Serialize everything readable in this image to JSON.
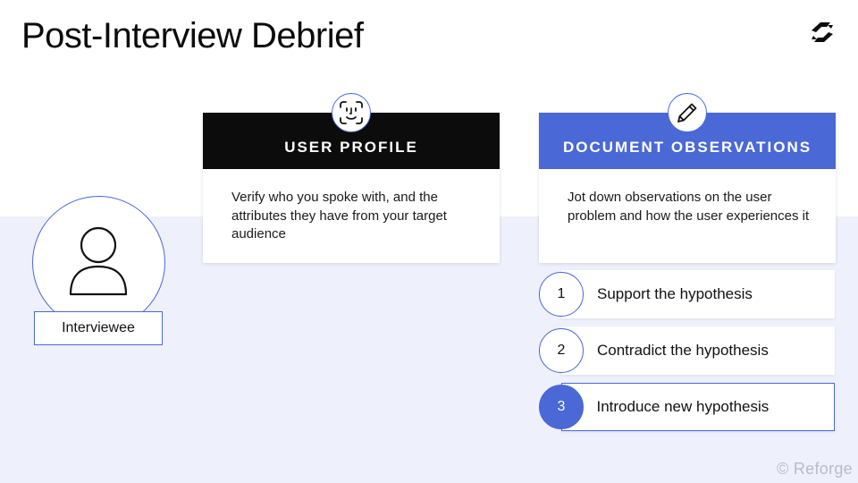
{
  "slide": {
    "title": "Post-Interview Debrief",
    "copyright": "© Reforge"
  },
  "interviewee": {
    "label": "Interviewee",
    "icon": "person-icon"
  },
  "profile_card": {
    "header": "USER PROFILE",
    "body": "Verify who you spoke with, and the attributes they have from your target audience",
    "icon": "face-scan-icon"
  },
  "observations_card": {
    "header": "DOCUMENT OBSERVATIONS",
    "body": "Jot down observations on the user problem and how the user experiences it",
    "icon": "pencil-icon"
  },
  "steps": [
    {
      "number": "1",
      "label": "Support the hypothesis"
    },
    {
      "number": "2",
      "label": "Contradict the hypothesis"
    },
    {
      "number": "3",
      "label": "Introduce new hypothesis",
      "highlighted": true
    }
  ],
  "colors": {
    "accent": "#4a68d6",
    "dark_header": "#0c0c0c",
    "band_background": "#eef0fb"
  }
}
